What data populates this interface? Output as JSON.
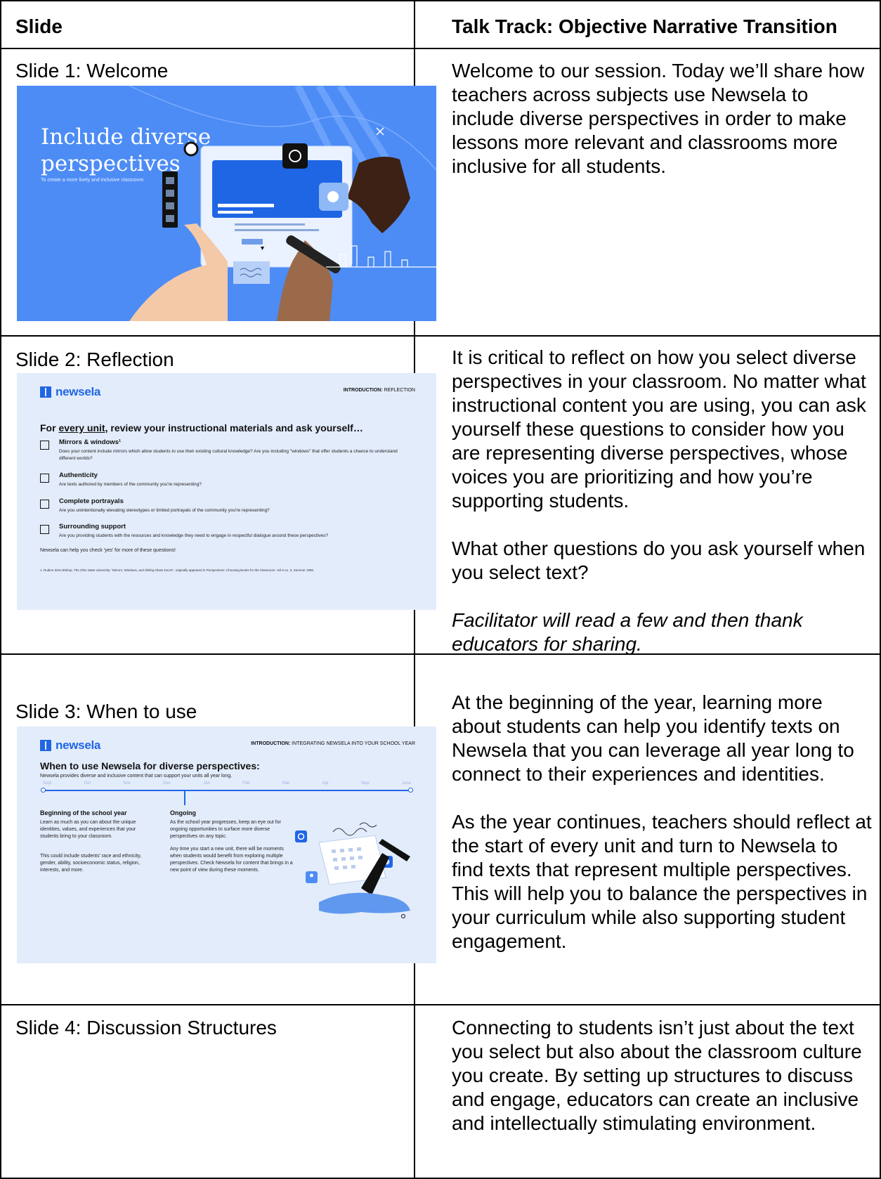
{
  "header": {
    "col1": "Slide",
    "col2": "Talk Track: Objective Narrative Transition"
  },
  "rows": [
    {
      "label": "Slide 1: Welcome",
      "talk": [
        "Welcome to our session. Today we’ll share how teachers across subjects use Newsela to include diverse perspectives in order to make lessons more relevant and classrooms more inclusive for all students."
      ],
      "slide": {
        "title_line1": "Include diverse",
        "title_line2": "perspectives",
        "subtitle": "To create a more lively and inclusive classroom"
      }
    },
    {
      "label": "Slide 2: Reflection",
      "talk": [
        "It is critical to reflect on how you select diverse perspectives in your classroom. No matter what instructional content you are using, you can ask yourself these questions to consider how you are representing diverse perspectives, whose voices you are prioritizing and how you’re supporting students.",
        "What other questions do you ask yourself when you select text?",
        "Facilitator will read a few and then thank educators for sharing."
      ],
      "slide": {
        "logo": "newsela",
        "crumb_bold": "INTRODUCTION:",
        "crumb_rest": " REFLECTION",
        "heading_pre": "For ",
        "heading_underlined": "every unit",
        "heading_post": ", review your instructional materials and ask yourself…",
        "items": [
          {
            "title": "Mirrors & windows¹",
            "desc": "Does your content include mirrors which allow students to use their existing cultural knowledge? Are you including \"windows\" that offer students a chance to understand different worlds?"
          },
          {
            "title": "Authenticity",
            "desc": "Are texts authored by members of the community you're representing?"
          },
          {
            "title": "Complete portrayals",
            "desc": "Are you unintentionally elevating stereotypes or limited portrayals of the community you're representing?"
          },
          {
            "title": "Surrounding support",
            "desc": "Are you providing students with the resources and knowledge they need to engage in respectful dialogue around these perspectives?"
          }
        ],
        "closing": "Newsela can help you check 'yes' for more of these questions!",
        "footnote": "1. Rudine Sims Bishop, The Ohio State University, \"Mirrors, Windows, and Sliding Glass Doors\", originally appeared in Perspectives: Choosing Books for the Classroom. Vol 6 no. 3, Summer 1990."
      }
    },
    {
      "label": "Slide 3: When to use",
      "talk": [
        "At the beginning of the year, learning more about students can help you identify texts on Newsela that you can leverage all year long to connect to their experiences and identities.",
        "As the year continues, teachers should reflect at the start of every unit and turn to Newsela to find texts that represent multiple perspectives. This will help you to balance the perspectives in your curriculum while also supporting student engagement."
      ],
      "slide": {
        "logo": "newsela",
        "crumb_bold": "INTRODUCTION:",
        "crumb_rest": " INTEGRATING NEWSELA INTO YOUR SCHOOL YEAR",
        "heading": "When to use Newsela for diverse perspectives:",
        "subheading": "Newsela provides diverse and inclusive content that can support your units all year long.",
        "months": [
          "Sept",
          "Oct",
          "Nov",
          "Dec",
          "Jan",
          "Feb",
          "Mar",
          "Apr",
          "May",
          "June"
        ],
        "col1_title": "Beginning of the school year",
        "col1_p1": "Learn as much as you can about the unique identities, values, and experiences that your students bring to your classroom.",
        "col1_p2": "This could include students' race and ethnicity, gender, ability, socioeconomic status, religion, interests, and more.",
        "col2_title": "Ongoing",
        "col2_p1": "As the school year progresses, keep an eye out for ongoing opportunities to surface more diverse perspectives on any topic.",
        "col2_p2": "Any time you start a new unit, there will be moments when students would benefit from exploring multiple perspectives. Check Newsela for content that brings in a new point of view during these moments."
      }
    },
    {
      "label": "Slide 4: Discussion Structures",
      "talk": [
        "Connecting to students isn’t just about the text you select but also about the classroom culture you create. By setting up structures to discuss and engage, educators can create an inclusive and intellectually stimulating environment."
      ]
    }
  ],
  "colors": {
    "slide1_bg": "#4d8cf5",
    "slide_light_bg": "#e3ecfb",
    "brand_blue": "#1f66e5"
  }
}
